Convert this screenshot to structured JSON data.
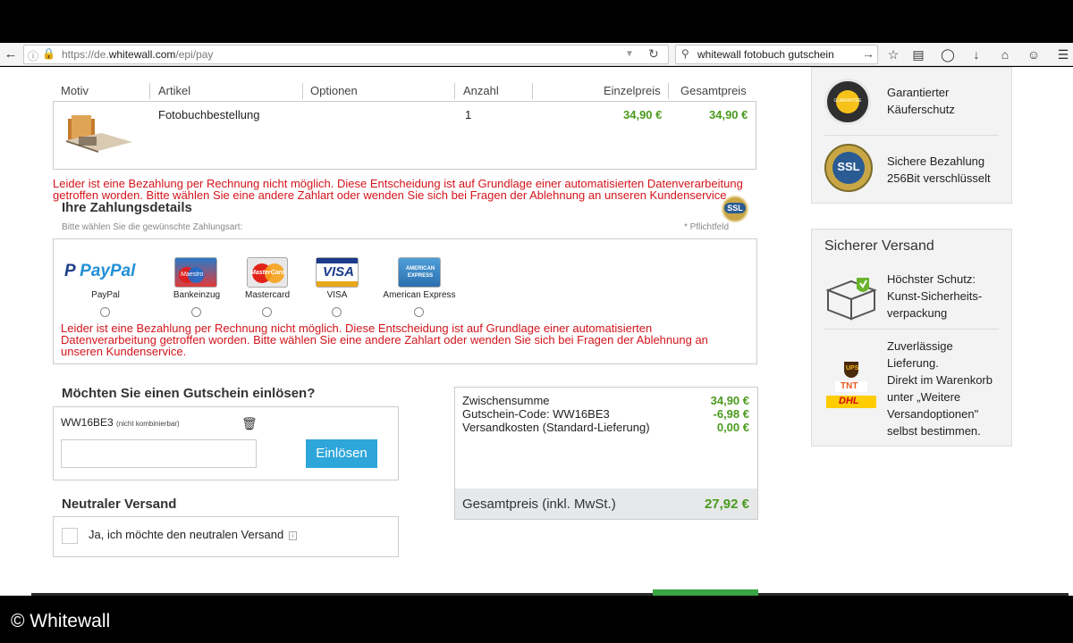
{
  "browser": {
    "url_prefix": "https://de.",
    "url_domain": "whitewall.com",
    "url_path": "/epi/pay",
    "search_query": "whitewall fotobuch gutschein"
  },
  "table": {
    "headers": [
      "Motiv",
      "Artikel",
      "Optionen",
      "Anzahl",
      "Einzelpreis",
      "Gesamtpreis"
    ],
    "rows": [
      {
        "artikel": "Fotobuchbestellung",
        "optionen": "",
        "anzahl": "1",
        "einzelpreis": "34,90 €",
        "gesamtpreis": "34,90 €"
      }
    ]
  },
  "error_message": "Leider ist eine Bezahlung per Rechnung nicht möglich. Diese Entscheidung ist auf Grundlage einer automatisierten Datenverarbeitung getroffen worden. Bitte wählen Sie eine andere Zahlart oder wenden Sie sich bei Fragen der Ablehnung an unseren Kundenservice.",
  "error_top_line1": "Leider ist eine Bezahlung per Rechnung nicht möglich. Diese Entscheidung ist auf Grundlage einer automatisierten Datenverarbeitung",
  "error_top_line2": "getroffen worden. Bitte wählen Sie eine andere Zahlart oder wenden Sie sich bei Fragen der Ablehnung an unseren Kundenservice.",
  "error_box_line1": "Leider ist eine Bezahlung per Rechnung nicht möglich. Diese Entscheidung ist auf Grundlage einer automatisierten",
  "error_box_line2": "Datenverarbeitung getroffen worden. Bitte wählen Sie eine andere Zahlart oder wenden Sie sich bei Fragen der Ablehnung an",
  "error_box_line3": "unseren Kundenservice.",
  "payment": {
    "title": "Ihre Zahlungsdetails",
    "hint": "Bitte wählen Sie die gewünschte Zahlungsart:",
    "required": "* Pflichtfeld",
    "methods": [
      "PayPal",
      "Bankeinzug",
      "Mastercard",
      "VISA",
      "American Express"
    ],
    "logo_paypal": "PayPal",
    "logo_maestro": "Maestro",
    "logo_mastercard": "MasterCard",
    "logo_visa": "VISA",
    "logo_amex": "AMERICAN EXPRESS",
    "ssl_badge": "SSL"
  },
  "voucher": {
    "title": "Möchten Sie einen Gutschein einlösen?",
    "code": "WW16BE3",
    "code_note": "(nicht kombinierbar)",
    "input_placeholder": "",
    "button": "Einlösen"
  },
  "neutral": {
    "title": "Neutraler Versand",
    "checkbox_label": "Ja, ich möchte den neutralen Versand",
    "info_icon": "i"
  },
  "summary": {
    "rows": [
      {
        "label": "Zwischensumme",
        "value": "34,90 €"
      },
      {
        "label": "Gutschein-Code: WW16BE3",
        "value": "-6,98 €"
      },
      {
        "label": "Versandkosten (Standard-Lieferung)",
        "value": "0,00 €"
      }
    ],
    "total_label": "Gesamtpreis (inkl. MwSt.)",
    "total_value": "27,92 €"
  },
  "sidebar": {
    "trust_line1": "Garantierter",
    "trust_line2": "Käuferschutz",
    "trust_badge": "GUARANTEE",
    "ssl_line1": "Sichere Bezahlung",
    "ssl_line2": "256Bit verschlüsselt",
    "ssl_badge": "SSL",
    "shipping_title": "Sicherer Versand",
    "protect_line1": "Höchster Schutz:",
    "protect_line2": "Kunst-Sicherheits-",
    "protect_line3": "verpackung",
    "delivery_line1": "Zuverlässige",
    "delivery_line2": "Lieferung.",
    "delivery_line3": "Direkt im Warenkorb",
    "delivery_line4": "unter „Weitere",
    "delivery_line5": "Versandoptionen\"",
    "delivery_line6": "selbst bestimmen.",
    "carrier_ups": "UPS",
    "carrier_tnt": "TNT",
    "carrier_dhl": "DHL"
  },
  "copyright": "© Whitewall",
  "colors": {
    "price_green": "#4a9a1e",
    "error_red": "#d3141b",
    "button_blue": "#2ea6da"
  }
}
